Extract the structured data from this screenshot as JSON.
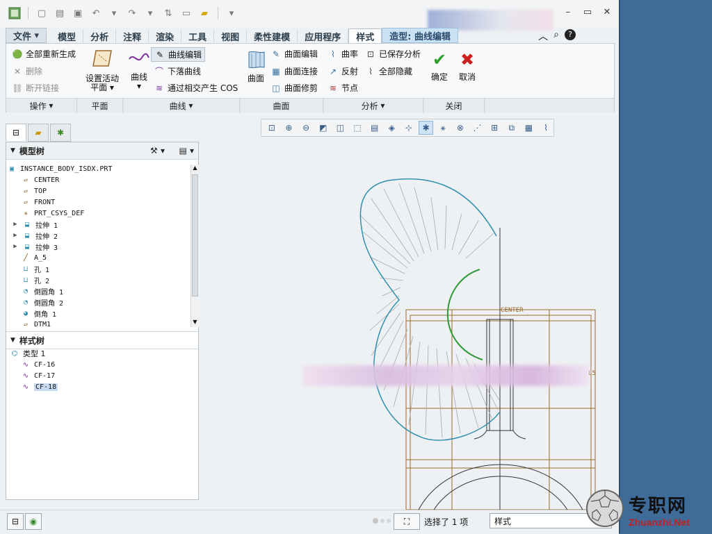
{
  "tabs": [
    "文件",
    "模型",
    "分析",
    "注释",
    "渲染",
    "工具",
    "视图",
    "柔性建模",
    "应用程序",
    "样式",
    "造型: 曲线编辑"
  ],
  "ribbon": {
    "ops": {
      "regen": "全部重新生成",
      "delete": "删除",
      "break": "断开链接"
    },
    "plane": {
      "set_active": "设置活动",
      "plane": "平面"
    },
    "curves": {
      "curve": "曲线",
      "curve_edit": "曲线编辑",
      "drop_curve": "下落曲线",
      "cos": "通过相交产生 COS"
    },
    "surfaces": {
      "surface": "曲面",
      "edit": "曲面编辑",
      "connect": "曲面连接",
      "trim": "曲面修剪"
    },
    "analysis": {
      "curvature": "曲率",
      "saved": "已保存分析",
      "reflect": "反射",
      "hide_all": "全部隐藏",
      "nodes": "节点"
    },
    "close": {
      "ok": "确定",
      "cancel": "取消"
    },
    "group_labels": [
      "操作",
      "平面",
      "曲线",
      "曲面",
      "分析",
      "关闭"
    ]
  },
  "model_tree": {
    "title": "模型树",
    "root": "INSTANCE_BODY_ISDX.PRT",
    "items": [
      "CENTER",
      "TOP",
      "FRONT",
      "PRT_CSYS_DEF",
      "拉伸 1",
      "拉伸 2",
      "拉伸 3",
      "A_5",
      "孔 1",
      "孔 2",
      "倒圆角 1",
      "倒圆角 2",
      "倒角 1",
      "DTM1"
    ]
  },
  "style_tree": {
    "title": "样式树",
    "root": "类型 1",
    "items": [
      "CF-16",
      "CF-17",
      "CF-18"
    ]
  },
  "status": {
    "selected": "选择了 1 项",
    "filter": "样式"
  },
  "canvas": {
    "center_label": "CENTER",
    "side_label": "L5"
  },
  "watermark": {
    "text": "专职网",
    "url": "Zhuanzhi.Net"
  },
  "colors": {
    "curve_blue": "#2e8fae",
    "curve_green": "#2f9a3a",
    "construction": "#9a6a2a"
  }
}
